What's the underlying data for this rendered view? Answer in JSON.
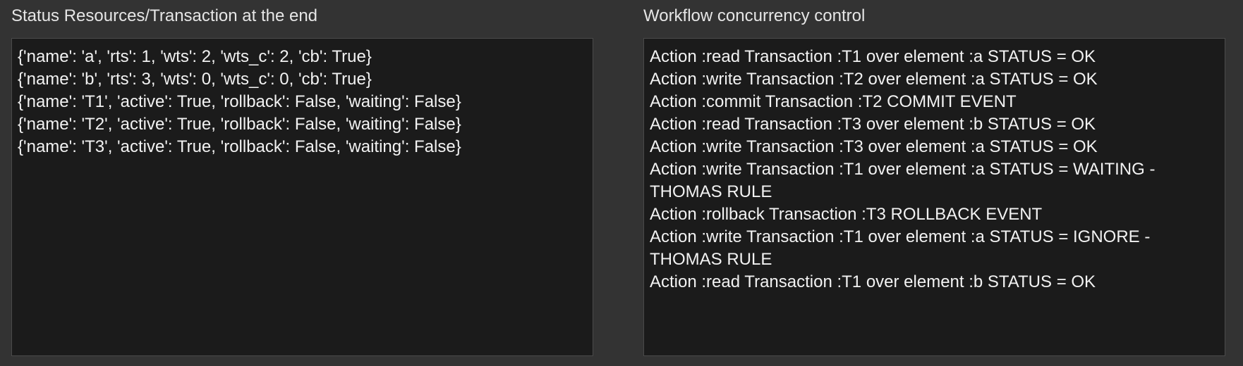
{
  "left_panel": {
    "title": "Status Resources/Transaction at the end",
    "lines": [
      "{'name': 'a', 'rts': 1, 'wts': 2, 'wts_c': 2, 'cb': True}",
      "{'name': 'b', 'rts': 3, 'wts': 0, 'wts_c': 0, 'cb': True}",
      "{'name': 'T1', 'active': True, 'rollback': False, 'waiting': False}",
      "{'name': 'T2', 'active': True, 'rollback': False, 'waiting': False}",
      "{'name': 'T3', 'active': True, 'rollback': False, 'waiting': False}"
    ]
  },
  "right_panel": {
    "title": "Workflow concurrency control",
    "lines": [
      "Action :read Transaction :T1 over element :a STATUS = OK",
      "Action :write Transaction :T2 over element :a STATUS = OK",
      "Action :commit Transaction :T2 COMMIT EVENT",
      "Action :read Transaction :T3 over element :b STATUS = OK",
      "Action :write Transaction :T3 over element :a STATUS = OK",
      "Action :write Transaction :T1 over element :a STATUS = WAITING -",
      "THOMAS RULE",
      "Action :rollback Transaction :T3 ROLLBACK EVENT",
      "Action :write Transaction :T1 over element :a STATUS = IGNORE -",
      "THOMAS RULE",
      "Action :read Transaction :T1 over element :b STATUS = OK"
    ]
  }
}
